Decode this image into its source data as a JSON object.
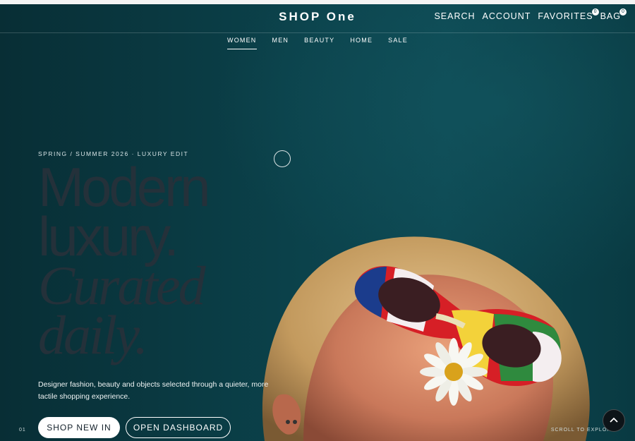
{
  "header": {
    "brand": "SHOP One",
    "utility": {
      "search": "SEARCH",
      "account": "ACCOUNT",
      "favorites": "FAVORITES",
      "favorites_count": "0",
      "bag": "BAG",
      "bag_count": "0"
    }
  },
  "nav": {
    "items": [
      {
        "label": "WOMEN",
        "active": true
      },
      {
        "label": "MEN",
        "active": false
      },
      {
        "label": "BEAUTY",
        "active": false
      },
      {
        "label": "HOME",
        "active": false
      },
      {
        "label": "SALE",
        "active": false
      }
    ]
  },
  "hero": {
    "eyebrow": "SPRING / SUMMER 2026 · LUXURY EDIT",
    "headline": {
      "line1": "Modern",
      "line2": "luxury.",
      "line3": "Curated",
      "line4": "daily."
    },
    "description": "Designer fashion, beauty and objects selected through a quieter, more tactile shopping experience.",
    "primary_cta": "SHOP NEW IN",
    "secondary_cta": "OPEN DASHBOARD",
    "slide_number": "01",
    "scroll_hint": "SCROLL TO EXPLORE"
  },
  "colors": {
    "background": "#0a3a42",
    "headline": "#24313a",
    "text": "#ffffff"
  },
  "icons": {
    "back_to_top": "chevron-up-icon"
  }
}
